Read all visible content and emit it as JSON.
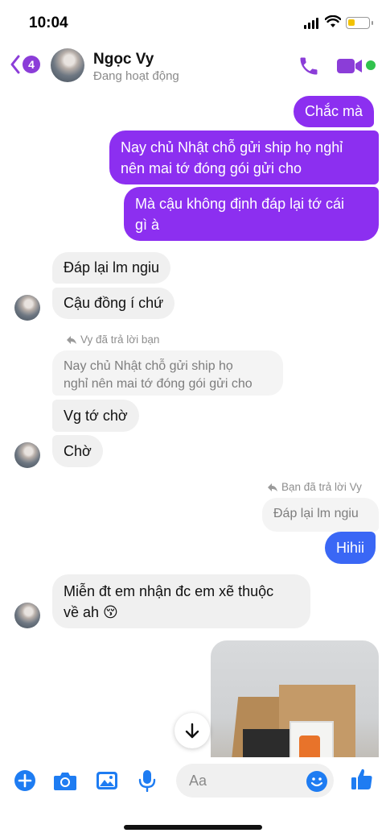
{
  "status_bar": {
    "time": "10:04"
  },
  "header": {
    "back_badge": "4",
    "contact_name": "Ngọc Vy",
    "contact_status": "Đang hoạt động",
    "accent_color": "#8b3dd8"
  },
  "messages": {
    "m1": "Chắc mà",
    "m2_line1": "Nay chủ Nhật chỗ gửi ship họ nghỉ",
    "m2_line2": "nên mai tớ đóng gói gửi cho",
    "m3_line1": "Mà cậu không định đáp lại tớ cái",
    "m3_line2": "gì à",
    "m4": "Đáp lại lm ngiu",
    "m5": "Cậu đồng í chứ",
    "reply_note_1": "Vy đã trả lời bạn",
    "quoted_1_line1": "Nay chủ Nhật chỗ gửi ship họ",
    "quoted_1_line2": "nghỉ nên mai tớ đóng gói gửi cho",
    "m6": "Vg tớ chờ",
    "m7": "Chờ",
    "reply_note_2": "Bạn đã trả lời Vy",
    "quoted_2": "Đáp lại lm ngiu",
    "m8": "Hihii",
    "m9_line1": "Miễn đt em nhận đc em xẽ thuộc",
    "m9_line2": "về ah 😚"
  },
  "composer": {
    "placeholder": "Aa"
  },
  "colors": {
    "outgoing_purple": "#8c2ff0",
    "outgoing_blue": "#3a67f5",
    "incoming_gray": "#f0f0f0",
    "icon_blue": "#1e7cf2"
  },
  "icons": [
    "back-chevron-icon",
    "phone-icon",
    "video-camera-icon",
    "reply-arrow-icon",
    "arrow-down-icon",
    "plus-icon",
    "camera-icon",
    "image-icon",
    "microphone-icon",
    "emoji-icon",
    "thumbs-up-icon"
  ]
}
